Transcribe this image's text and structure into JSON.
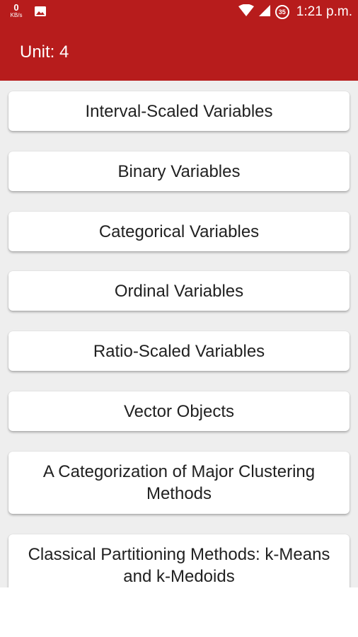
{
  "status_bar": {
    "net_speed_value": "0",
    "net_speed_unit": "KB/s",
    "battery_level": "35",
    "time": "1:21 p.m.",
    "icons": [
      "gallery-icon",
      "wifi-icon",
      "signal-icon",
      "battery-icon"
    ]
  },
  "app_bar": {
    "title": "Unit: 4",
    "color": "#b71c1c"
  },
  "topics": [
    {
      "label": "Interval-Scaled Variables"
    },
    {
      "label": "Binary Variables"
    },
    {
      "label": "Categorical Variables"
    },
    {
      "label": "Ordinal Variables"
    },
    {
      "label": "Ratio-Scaled Variables"
    },
    {
      "label": "Vector Objects"
    },
    {
      "label": "A Categorization of Major Clustering Methods"
    },
    {
      "label": "Classical Partitioning Methods: k-Means and k-Medoids"
    }
  ]
}
